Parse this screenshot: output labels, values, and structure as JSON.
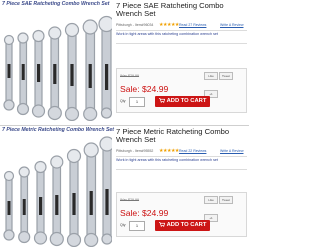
{
  "sae": {
    "image_title": "7 Piece SAE Ratcheting Combo Wrench Set",
    "title": "7 Piece SAE Ratcheting Combo Wrench Set",
    "sku": "Pittsburgh - Item#96034",
    "stars": "★★★★★",
    "reviews": "Read 27 Reviews",
    "write_review": "Write A Review",
    "blurb": "Work in tight areas with this ratcheting combination wrench set",
    "was": "Was $29.99",
    "social": [
      "Like",
      "Tweet",
      "+1"
    ],
    "sale": "Sale: $24.99",
    "qty_label": "Qty",
    "qty": "1",
    "add_to_cart": "ADD TO CART"
  },
  "metric": {
    "image_title": "7 Piece Metric Ratcheting Combo Wrench Set",
    "title": "7 Piece Metric Ratcheting Combo Wrench Set",
    "sku": "Pittsburgh - Item#95552",
    "stars": "★★★★★",
    "reviews": "Read 22 Reviews",
    "write_review": "Write A Review",
    "blurb": "Work in tight areas with this ratcheting combination wrench set",
    "was": "Was $29.99",
    "social": [
      "Like",
      "Tweet",
      "+1"
    ],
    "sale": "Sale: $24.99",
    "qty_label": "Qty",
    "qty": "1",
    "add_to_cart": "ADD TO CART"
  },
  "colors": {
    "sale_red": "#cc1111",
    "button_red": "#cc1515",
    "link_blue": "#2a5db0",
    "title_blue": "#3b4a8a"
  },
  "icons": [
    "wrench-set-image",
    "star-icon",
    "cart-icon"
  ]
}
